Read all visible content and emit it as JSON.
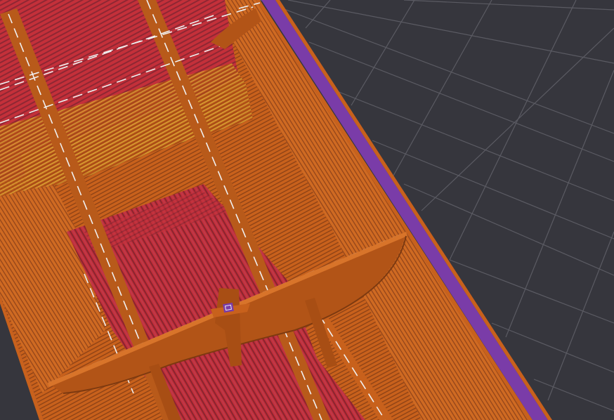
{
  "viewport": {
    "view": "3d-gcode-preview",
    "colors": {
      "background": "#36363d",
      "grid": "#5a5a62",
      "perimeter": "#c8611c",
      "perimeter_dark": "#8a3f12",
      "infill": "#c4303a",
      "solid_infill": "#b8405a",
      "skirt": "#7a3ca8",
      "travel": "#e8e8e8",
      "bridge": "#c8c832"
    }
  }
}
